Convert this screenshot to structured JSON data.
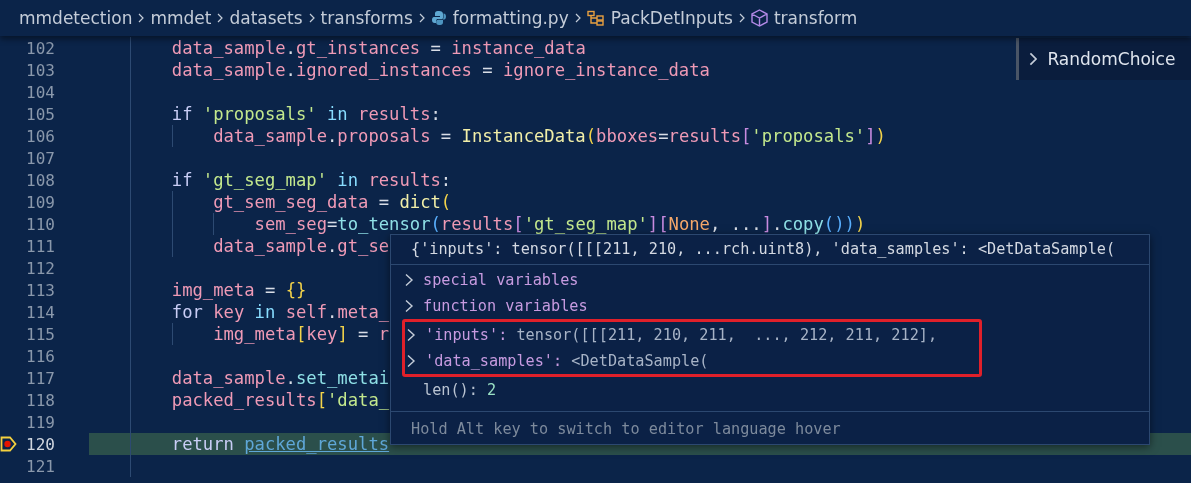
{
  "breadcrumb": [
    {
      "label": "mmdetection",
      "kind": "folder"
    },
    {
      "label": "mmdet",
      "kind": "folder"
    },
    {
      "label": "datasets",
      "kind": "folder"
    },
    {
      "label": "transforms",
      "kind": "folder"
    },
    {
      "label": "formatting.py",
      "kind": "python-file"
    },
    {
      "label": "PackDetInputs",
      "kind": "class"
    },
    {
      "label": "transform",
      "kind": "method"
    }
  ],
  "sticky_scroll": {
    "label": "RandomChoice"
  },
  "lines": [
    {
      "number": "102",
      "current": false,
      "tokens": [
        {
          "text": "        data_sample",
          "kind": "var"
        },
        {
          "text": ".",
          "kind": "p"
        },
        {
          "text": "gt_instances",
          "kind": "var"
        },
        {
          "text": " = ",
          "kind": "p"
        },
        {
          "text": "instance_data",
          "kind": "var"
        }
      ]
    },
    {
      "number": "103",
      "current": false,
      "tokens": [
        {
          "text": "        data_sample",
          "kind": "var"
        },
        {
          "text": ".",
          "kind": "p"
        },
        {
          "text": "ignored_instances",
          "kind": "var"
        },
        {
          "text": " = ",
          "kind": "p"
        },
        {
          "text": "ignore_instance_data",
          "kind": "var"
        }
      ]
    },
    {
      "number": "104",
      "current": false
    },
    {
      "number": "105",
      "current": false,
      "tokens": [
        {
          "text": "        if ",
          "kind": "kw"
        },
        {
          "text": "'proposals'",
          "kind": "str"
        },
        {
          "text": " in ",
          "kind": "op"
        },
        {
          "text": "results",
          "kind": "var"
        },
        {
          "text": ":",
          "kind": "p"
        }
      ]
    },
    {
      "number": "106",
      "current": false,
      "tokens": [
        {
          "text": "            data_sample",
          "kind": "var"
        },
        {
          "text": ".",
          "kind": "p"
        },
        {
          "text": "proposals",
          "kind": "var"
        },
        {
          "text": " = ",
          "kind": "p"
        },
        {
          "text": "InstanceData",
          "kind": "cls"
        },
        {
          "text": "(",
          "kind": "b1"
        },
        {
          "text": "bboxes",
          "kind": "var"
        },
        {
          "text": "=",
          "kind": "p"
        },
        {
          "text": "results",
          "kind": "var"
        },
        {
          "text": "[",
          "kind": "b2"
        },
        {
          "text": "'proposals'",
          "kind": "str"
        },
        {
          "text": "]",
          "kind": "b2"
        },
        {
          "text": ")",
          "kind": "b1"
        }
      ]
    },
    {
      "number": "107",
      "current": false
    },
    {
      "number": "108",
      "current": false,
      "tokens": [
        {
          "text": "        if ",
          "kind": "kw"
        },
        {
          "text": "'gt_seg_map'",
          "kind": "str"
        },
        {
          "text": " in ",
          "kind": "op"
        },
        {
          "text": "results",
          "kind": "var"
        },
        {
          "text": ":",
          "kind": "p"
        }
      ]
    },
    {
      "number": "109",
      "current": false,
      "tokens": [
        {
          "text": "            gt_sem_seg_data",
          "kind": "var"
        },
        {
          "text": " = ",
          "kind": "p"
        },
        {
          "text": "dict",
          "kind": "cls"
        },
        {
          "text": "(",
          "kind": "b1"
        }
      ]
    },
    {
      "number": "110",
      "current": false,
      "tokens": [
        {
          "text": "                sem_seg",
          "kind": "var"
        },
        {
          "text": "=",
          "kind": "p"
        },
        {
          "text": "to_tensor",
          "kind": "fn"
        },
        {
          "text": "(",
          "kind": "b3"
        },
        {
          "text": "results",
          "kind": "var"
        },
        {
          "text": "[",
          "kind": "b2"
        },
        {
          "text": "'gt_seg_map'",
          "kind": "str"
        },
        {
          "text": "][",
          "kind": "b2"
        },
        {
          "text": "None",
          "kind": "const"
        },
        {
          "text": ", ...",
          "kind": "p"
        },
        {
          "text": "]",
          "kind": "b2"
        },
        {
          "text": ".",
          "kind": "p"
        },
        {
          "text": "copy",
          "kind": "fn"
        },
        {
          "text": "())",
          "kind": "b3"
        },
        {
          "text": ")",
          "kind": "b1"
        }
      ]
    },
    {
      "number": "111",
      "current": false,
      "tokens": [
        {
          "text": "            data_sample",
          "kind": "var"
        },
        {
          "text": ".",
          "kind": "p"
        },
        {
          "text": "gt_se",
          "kind": "var"
        }
      ]
    },
    {
      "number": "112",
      "current": false
    },
    {
      "number": "113",
      "current": false,
      "tokens": [
        {
          "text": "        img_meta",
          "kind": "var"
        },
        {
          "text": " = ",
          "kind": "p"
        },
        {
          "text": "{}",
          "kind": "b1"
        }
      ]
    },
    {
      "number": "114",
      "current": false,
      "tokens": [
        {
          "text": "        for ",
          "kind": "kw"
        },
        {
          "text": "key",
          "kind": "var"
        },
        {
          "text": " in ",
          "kind": "op"
        },
        {
          "text": "self",
          "kind": "var"
        },
        {
          "text": ".",
          "kind": "p"
        },
        {
          "text": "meta_",
          "kind": "var"
        }
      ]
    },
    {
      "number": "115",
      "current": false,
      "tokens": [
        {
          "text": "            img_meta",
          "kind": "var"
        },
        {
          "text": "[",
          "kind": "b1"
        },
        {
          "text": "key",
          "kind": "var"
        },
        {
          "text": "]",
          "kind": "b1"
        },
        {
          "text": " = ",
          "kind": "p"
        },
        {
          "text": "r",
          "kind": "var"
        }
      ]
    },
    {
      "number": "116",
      "current": false
    },
    {
      "number": "117",
      "current": false,
      "tokens": [
        {
          "text": "        data_sample",
          "kind": "var"
        },
        {
          "text": ".",
          "kind": "p"
        },
        {
          "text": "set_metai",
          "kind": "fn"
        }
      ]
    },
    {
      "number": "118",
      "current": false,
      "tokens": [
        {
          "text": "        packed_results",
          "kind": "var"
        },
        {
          "text": "[",
          "kind": "b1"
        },
        {
          "text": "'data_",
          "kind": "str"
        }
      ]
    },
    {
      "number": "119",
      "current": false
    },
    {
      "number": "120",
      "current": true,
      "tokens": [
        {
          "text": "        return ",
          "kind": "kw"
        },
        {
          "text": "packed_results",
          "kind": "link"
        }
      ]
    },
    {
      "number": "121",
      "current": false
    }
  ],
  "hover": {
    "header": "{'inputs': tensor([[[211, 210, ...rch.uint8), 'data_samples': <DetDataSample(",
    "rows": [
      {
        "name": "special variables",
        "kind": "group",
        "expandable": true,
        "highlighted": false
      },
      {
        "name": "function variables",
        "kind": "group",
        "expandable": true,
        "highlighted": false
      },
      {
        "name": "'inputs':",
        "value": "tensor([[[211, 210, 211,  ..., 212, 211, 212],",
        "kind": "entry",
        "expandable": true,
        "highlighted": true
      },
      {
        "name": "'data_samples':",
        "value": "<DetDataSample(",
        "kind": "entry",
        "expandable": true,
        "highlighted": true
      },
      {
        "name": "len():",
        "value": "2",
        "kind": "length",
        "expandable": false,
        "highlighted": false
      }
    ],
    "hint": "Hold Alt key to switch to editor language hover"
  }
}
